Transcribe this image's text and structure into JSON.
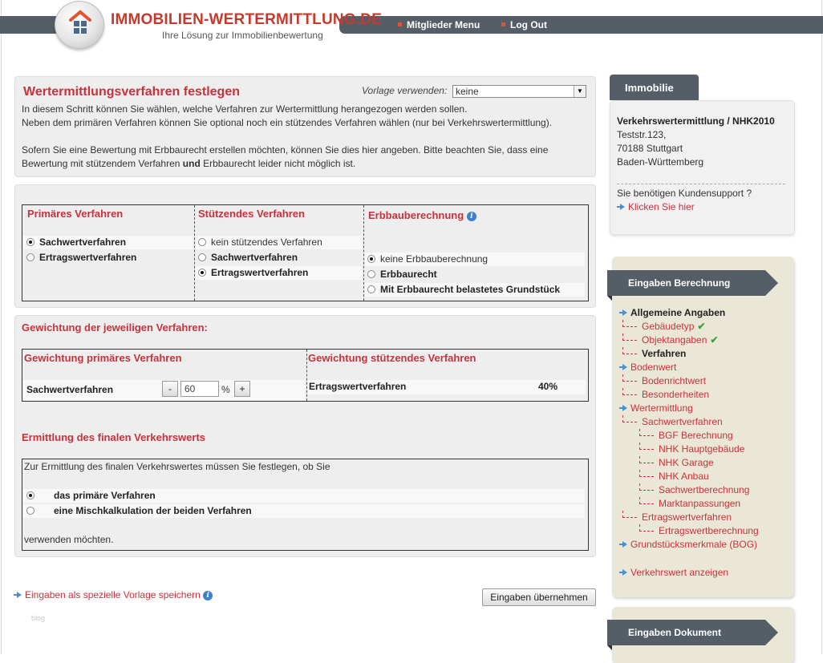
{
  "header": {
    "logo_title": "IMMOBILIEN-WERTERMITTLUNG.DE",
    "logo_subtitle": "Ihre Lösung zur Immobilienbewertung",
    "nav": [
      "Mitglieder Menu",
      "Log Out"
    ]
  },
  "intro": {
    "title": "Wertermittlungsverfahren festlegen",
    "template_label": "Vorlage verwenden:",
    "template_value": "keine",
    "lines": [
      "In diesem Schritt können Sie wählen, welche Verfahren zur Wertermittlung herangezogen werden sollen.",
      "Neben dem primären Verfahren können Sie optional noch ein stützendes Verfahren wählen (nur bei Verkehrswertermittlung).",
      "Sofern Sie eine Bewertung mit Erbbaurecht erstellen möchten, können Sie dies hier angeben. Bitte beachten Sie, dass eine",
      "Bewertung mit stützendem Verfahren",
      "und",
      "Erbbaurecht leider nicht möglich ist."
    ]
  },
  "methods": {
    "primary": {
      "heading": "Primäres Verfahren",
      "options": [
        {
          "label": "Sachwertverfahren",
          "selected": true
        },
        {
          "label": "Ertragswertverfahren",
          "selected": false
        }
      ]
    },
    "supporting": {
      "heading": "Stützendes Verfahren",
      "options": [
        {
          "label": "kein stützendes Verfahren",
          "selected": false
        },
        {
          "label": "Sachwertverfahren",
          "selected": false
        },
        {
          "label": "Ertragswertverfahren",
          "selected": true
        }
      ]
    },
    "leasehold": {
      "heading": "Erbbauberechnung",
      "options": [
        {
          "label": "keine Erbbauberechnung",
          "selected": true
        },
        {
          "label": "Erbbaurecht",
          "selected": false
        },
        {
          "label": "Mit Erbbaurecht belastetes Grundstück",
          "selected": false
        }
      ]
    }
  },
  "weighting": {
    "title": "Gewichtung der jeweiligen Verfahren:",
    "primary_heading": "Gewichtung primäres Verfahren",
    "supporting_heading": "Gewichtung stützendes Verfahren",
    "primary_label": "Sachwertverfahren",
    "minus": "-",
    "plus": "+",
    "primary_value": "60",
    "unit": "%",
    "supporting_label": "Ertragswertverfahren",
    "supporting_value": "40%"
  },
  "final": {
    "title": "Ermittlung des finalen Verkehrswerts",
    "prompt": "Zur Ermittlung des finalen Verkehrswertes müssen Sie festlegen, ob Sie",
    "options": [
      {
        "label": "das primäre Verfahren",
        "selected": true
      },
      {
        "label": "eine Mischkalkulation der beiden Verfahren",
        "selected": false
      }
    ],
    "suffix": "verwenden möchten."
  },
  "footer": {
    "save_template_link": "Eingaben als spezielle Vorlage speichern",
    "submit_button": "Eingaben übernehmen",
    "blog": "blog"
  },
  "sidebar": {
    "property_tab": "Immobilie",
    "property_title": "Verkehrswertermittlung / NHK2010",
    "address": [
      "Teststr.123,",
      "70188 Stuttgart",
      "Baden-Württemberg"
    ],
    "support_question": "Sie benötigen Kundensupport ?",
    "support_link": "Klicken Sie hier",
    "calc_heading": "Eingaben Berechnung",
    "calc_nav": [
      {
        "label": "Allgemeine Angaben",
        "level": 0,
        "style": "bold",
        "check": false
      },
      {
        "label": "Gebäudetyp",
        "level": 1,
        "style": "link",
        "check": true
      },
      {
        "label": "Objektangaben",
        "level": 1,
        "style": "link",
        "check": true
      },
      {
        "label": "Verfahren",
        "level": 1,
        "style": "bold",
        "check": false
      },
      {
        "label": "Bodenwert",
        "level": 0,
        "style": "link",
        "check": false
      },
      {
        "label": "Bodenrichtwert",
        "level": 1,
        "style": "link",
        "check": false
      },
      {
        "label": "Besonderheiten",
        "level": 1,
        "style": "link",
        "check": false
      },
      {
        "label": "Wertermittlung",
        "level": 0,
        "style": "link",
        "check": false
      },
      {
        "label": "Sachwertverfahren",
        "level": 1,
        "style": "link",
        "check": false
      },
      {
        "label": "BGF Berechnung",
        "level": 2,
        "style": "link",
        "check": false
      },
      {
        "label": "NHK Hauptgebäude",
        "level": 2,
        "style": "link",
        "check": false
      },
      {
        "label": "NHK Garage",
        "level": 2,
        "style": "link",
        "check": false
      },
      {
        "label": "NHK Anbau",
        "level": 2,
        "style": "link",
        "check": false
      },
      {
        "label": "Sachwertberechnung",
        "level": 2,
        "style": "link",
        "check": false
      },
      {
        "label": "Marktanpassungen",
        "level": 2,
        "style": "link",
        "check": false
      },
      {
        "label": "Ertragswertverfahren",
        "level": 1,
        "style": "link",
        "check": false
      },
      {
        "label": "Ertragswertberechnung",
        "level": 2,
        "style": "link",
        "check": false
      },
      {
        "label": "Grundstücksmerkmale (BOG)",
        "level": 0,
        "style": "link",
        "check": false
      }
    ],
    "show_value_link": "Verkehrswert anzeigen",
    "doc_heading": "Eingaben Dokument"
  }
}
